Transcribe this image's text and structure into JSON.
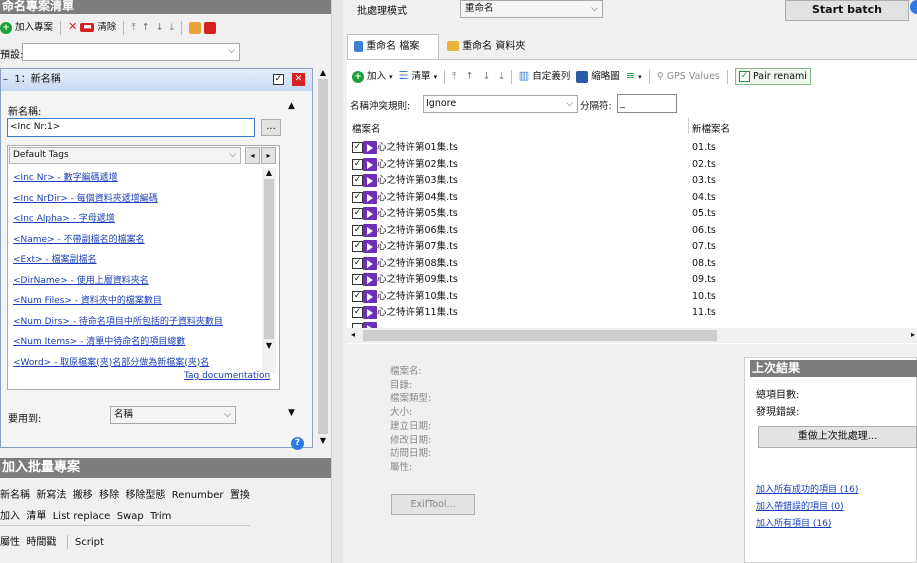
{
  "left": {
    "title": "命名專案清單",
    "toolbar": {
      "add": "加入專案",
      "clear": "清除"
    },
    "preset_label": "預設:",
    "rule": {
      "title": "1：新名稱",
      "newname_label": "新名稱:",
      "newname_value": "<Inc Nr:1>",
      "more_btn": "..."
    },
    "tags": {
      "dropdown": "Default Tags",
      "items": [
        "<Inc Nr> - 數字編碼遞增",
        "<Inc NrDir> - 每個資料夾遞增編碼",
        "<Inc Alpha> - 字母遞增",
        "<Name> - 不帶副檔名的檔案名",
        "<Ext> - 檔案副檔名",
        "<DirName> - 使用上層資料夾名",
        "<Num Files> - 資料夾中的檔案數目",
        "<Num Dirs> - 待命名項目中所包括的子資料夾數目",
        "<Num Items> - 清單中待命名的項目總數",
        "<Word> - 取原檔案(夾)名部分做為新檔案(夾)名"
      ],
      "doc": "Tag documentation"
    },
    "apply_label": "要用到:",
    "apply_value": "名稱",
    "batch": {
      "title": "加入批量專案",
      "row1": [
        "新名稱",
        "新寫法",
        "搬移",
        "移除",
        "移除型態",
        "Renumber",
        "置換"
      ],
      "row2": [
        "加入",
        "清單",
        "List replace",
        "Swap",
        "Trim"
      ],
      "row3": [
        "屬性",
        "時間戳",
        "Script"
      ]
    }
  },
  "right": {
    "mode_label": "批處理模式",
    "mode_value": "重命名",
    "start": "Start batch",
    "tabs": [
      "重命名 檔案",
      "重命名 資料夾"
    ],
    "toolbar": {
      "add": "加入",
      "list": "清單",
      "custom": "自定義列",
      "thumbs": "縮略圖",
      "gps": "GPS Values",
      "pair": "Pair renami"
    },
    "conflict_label": "名稱沖突規則:",
    "conflict_value": "Ignore",
    "sep_label": "分隔符:",
    "sep_value": "_",
    "col_file": "檔案名",
    "col_new": "新檔案名",
    "files": [
      {
        "name": "心之特许第01集.ts",
        "new": "01.ts"
      },
      {
        "name": "心之特许第02集.ts",
        "new": "02.ts"
      },
      {
        "name": "心之特许第03集.ts",
        "new": "03.ts"
      },
      {
        "name": "心之特许第04集.ts",
        "new": "04.ts"
      },
      {
        "name": "心之特许第05集.ts",
        "new": "05.ts"
      },
      {
        "name": "心之特许第06集.ts",
        "new": "06.ts"
      },
      {
        "name": "心之特许第07集.ts",
        "new": "07.ts"
      },
      {
        "name": "心之特许第08集.ts",
        "new": "08.ts"
      },
      {
        "name": "心之特许第09集.ts",
        "new": "09.ts"
      },
      {
        "name": "心之特许第10集.ts",
        "new": "10.ts"
      },
      {
        "name": "心之特许第11集.ts",
        "new": "11.ts"
      }
    ],
    "props": [
      "檔案名:",
      "目錄:",
      "檔案類型:",
      "大小:",
      "建立日期:",
      "修改日期:",
      "訪問日期:",
      "屬性:"
    ],
    "exif": "ExifTool...",
    "results": {
      "title": "上次結果",
      "total": "總項目數:",
      "errors": "發現錯誤:",
      "redo": "重做上次批處理...",
      "links": [
        "加入所有成功的項目 (16)",
        "加入帶錯誤的項目 (0)",
        "加入所有項目 (16)"
      ]
    }
  }
}
